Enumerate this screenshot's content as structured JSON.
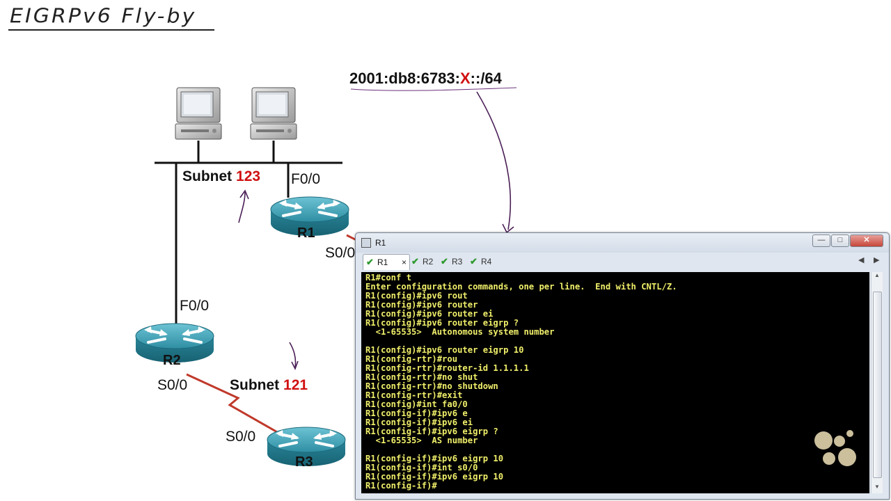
{
  "slide": {
    "title": "EIGRPv6 Fly-by",
    "ipv6_prefix_pre": "2001:db8:6783:",
    "ipv6_prefix_x": "X",
    "ipv6_prefix_post": "::/64",
    "subnet_123_word": "Subnet",
    "subnet_123_num": "123",
    "subnet_121_word": "Subnet",
    "subnet_121_num": "121",
    "routers": {
      "r1": "R1",
      "r2": "R2",
      "r3": "R3"
    },
    "interfaces": {
      "r1_f00": "F0/0",
      "r1_s00": "S0/0",
      "r2_f00": "F0/0",
      "r2_s00": "S0/0",
      "r3_s00": "S0/0"
    }
  },
  "window": {
    "title": "R1",
    "controls": {
      "minimize": "—",
      "maximize": "□",
      "close": "✕"
    },
    "tabs": [
      {
        "label": "R1",
        "active": true,
        "close": "×"
      },
      {
        "label": "R2",
        "active": false
      },
      {
        "label": "R3",
        "active": false
      },
      {
        "label": "R4",
        "active": false
      }
    ],
    "tab_nav": {
      "prev": "◀",
      "next": "▶"
    },
    "terminal_lines": [
      "R1#conf t",
      "Enter configuration commands, one per line.  End with CNTL/Z.",
      "R1(config)#ipv6 rout",
      "R1(config)#ipv6 router",
      "R1(config)#ipv6 router ei",
      "R1(config)#ipv6 router eigrp ?",
      "  <1-65535>  Autonomous system number",
      "",
      "R1(config)#ipv6 router eigrp 10",
      "R1(config-rtr)#rou",
      "R1(config-rtr)#router-id 1.1.1.1",
      "R1(config-rtr)#no shut",
      "R1(config-rtr)#no shutdown",
      "R1(config-rtr)#exit",
      "R1(config)#int fa0/0",
      "R1(config-if)#ipv6 e",
      "R1(config-if)#ipv6 ei",
      "R1(config-if)#ipv6 eigrp ?",
      "  <1-65535>  AS number",
      "",
      "R1(config-if)#ipv6 eigrp 10",
      "R1(config-if)#int s0/0",
      "R1(config-if)#ipv6 eigrp 10",
      "R1(config-if)#"
    ],
    "terminal_text_color": "#f0ef6a",
    "terminal_bg": "#000000"
  },
  "colors": {
    "accent_red": "#d01010",
    "router_body": "#2e93a8",
    "serial_link": "#c0392b"
  },
  "icons": [
    "pc-icon",
    "router-icon",
    "window-icon",
    "check-icon",
    "logo-icon"
  ]
}
